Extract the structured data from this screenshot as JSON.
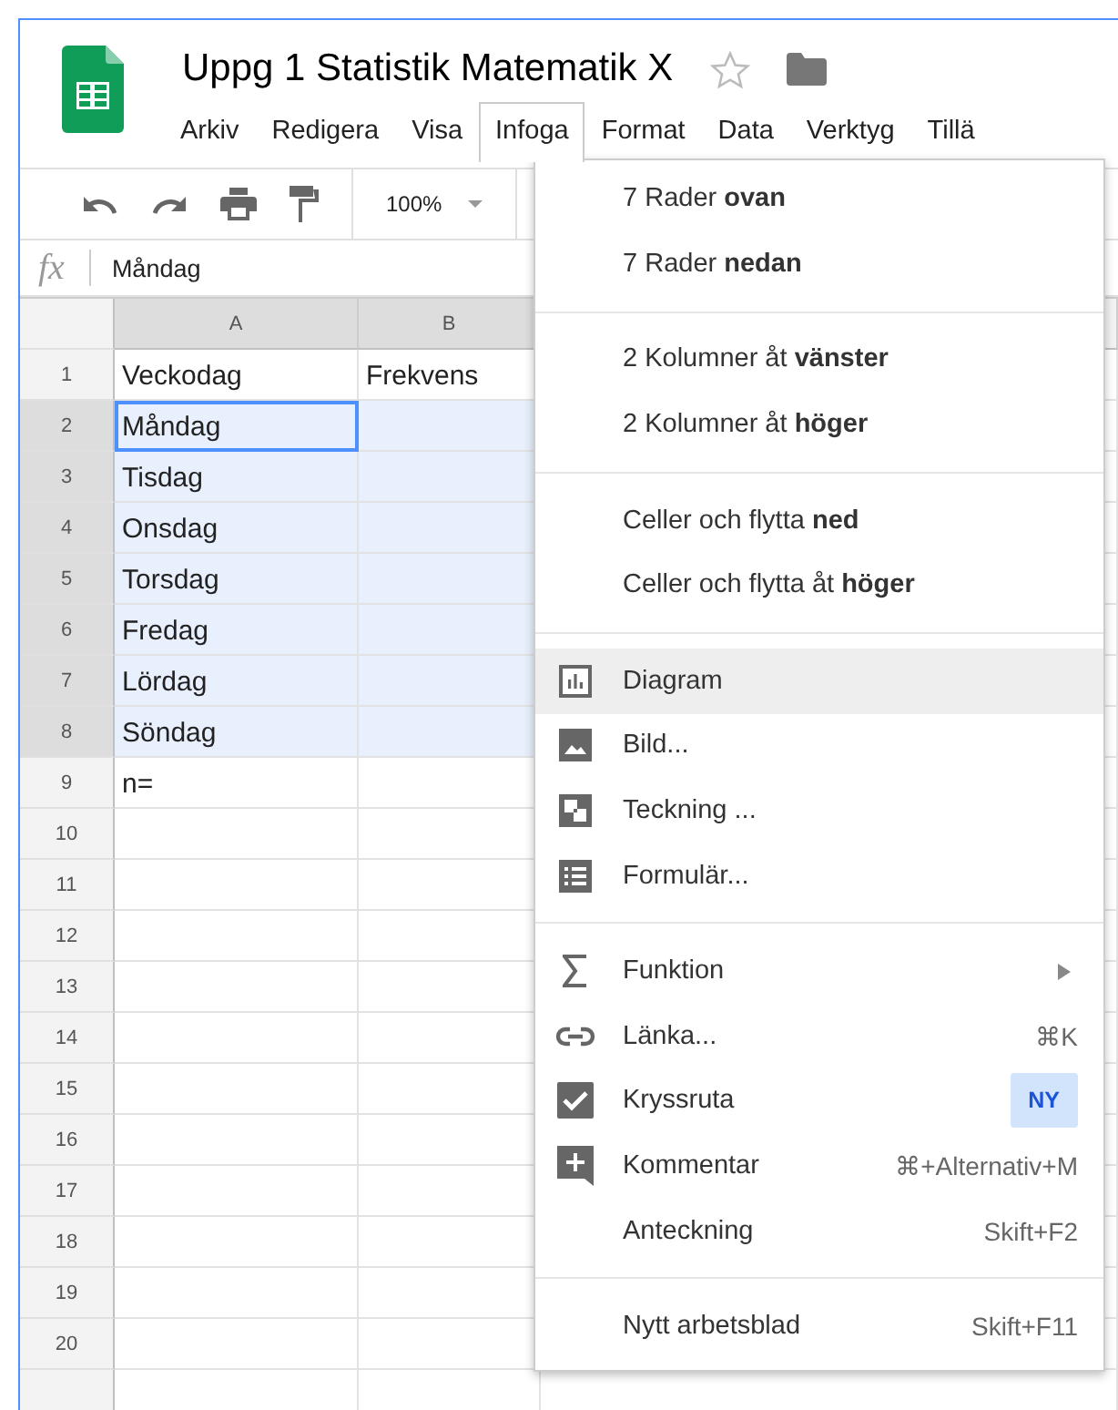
{
  "document": {
    "title": "Uppg 1 Statistik Matematik X"
  },
  "menubar": [
    {
      "label": "Arkiv",
      "selected": false
    },
    {
      "label": "Redigera",
      "selected": false
    },
    {
      "label": "Visa",
      "selected": false
    },
    {
      "label": "Infoga",
      "selected": true
    },
    {
      "label": "Format",
      "selected": false
    },
    {
      "label": "Data",
      "selected": false
    },
    {
      "label": "Verktyg",
      "selected": false
    },
    {
      "label": "Tillä",
      "selected": false
    }
  ],
  "toolbar": {
    "zoom": "100%"
  },
  "formula_bar": {
    "label": "fx",
    "value": "Måndag"
  },
  "columns": [
    {
      "label": "A",
      "selected": true
    },
    {
      "label": "B",
      "selected": true
    }
  ],
  "rows": [
    {
      "number": "1",
      "selected": false,
      "cells": [
        {
          "text": "Veckodag",
          "selected": false,
          "active": false
        },
        {
          "text": "Frekvens",
          "selected": false,
          "active": false
        }
      ]
    },
    {
      "number": "2",
      "selected": true,
      "cells": [
        {
          "text": "Måndag",
          "selected": true,
          "active": true
        },
        {
          "selected": true,
          "active": false
        }
      ]
    },
    {
      "number": "3",
      "selected": true,
      "cells": [
        {
          "text": "Tisdag",
          "selected": true,
          "active": false
        },
        {
          "selected": true,
          "active": false
        }
      ]
    },
    {
      "number": "4",
      "selected": true,
      "cells": [
        {
          "text": "Onsdag",
          "selected": true,
          "active": false
        },
        {
          "selected": true,
          "active": false
        }
      ]
    },
    {
      "number": "5",
      "selected": true,
      "cells": [
        {
          "text": "Torsdag",
          "selected": true,
          "active": false
        },
        {
          "selected": true,
          "active": false
        }
      ]
    },
    {
      "number": "6",
      "selected": true,
      "cells": [
        {
          "text": "Fredag",
          "selected": true,
          "active": false
        },
        {
          "selected": true,
          "active": false
        }
      ]
    },
    {
      "number": "7",
      "selected": true,
      "cells": [
        {
          "text": "Lördag",
          "selected": true,
          "active": false
        },
        {
          "selected": true,
          "active": false
        }
      ]
    },
    {
      "number": "8",
      "selected": true,
      "cells": [
        {
          "text": "Söndag",
          "selected": true,
          "active": false
        },
        {
          "selected": true,
          "active": false
        }
      ]
    },
    {
      "number": "9",
      "selected": false,
      "cells": [
        {
          "text": "n=",
          "selected": false,
          "active": false
        },
        {
          "selected": false,
          "active": false
        }
      ]
    },
    {
      "number": "10",
      "selected": false,
      "cells": [
        {
          "selected": false,
          "active": false
        },
        {
          "selected": false,
          "active": false
        }
      ]
    },
    {
      "number": "11",
      "selected": false,
      "cells": [
        {
          "selected": false,
          "active": false
        },
        {
          "selected": false,
          "active": false
        }
      ]
    },
    {
      "number": "12",
      "selected": false,
      "cells": [
        {
          "selected": false,
          "active": false
        },
        {
          "selected": false,
          "active": false
        }
      ]
    },
    {
      "number": "13",
      "selected": false,
      "cells": [
        {
          "selected": false,
          "active": false
        },
        {
          "selected": false,
          "active": false
        }
      ]
    },
    {
      "number": "14",
      "selected": false,
      "cells": [
        {
          "selected": false,
          "active": false
        },
        {
          "selected": false,
          "active": false
        }
      ]
    },
    {
      "number": "15",
      "selected": false,
      "cells": [
        {
          "selected": false,
          "active": false
        },
        {
          "selected": false,
          "active": false
        }
      ]
    },
    {
      "number": "16",
      "selected": false,
      "cells": [
        {
          "selected": false,
          "active": false
        },
        {
          "selected": false,
          "active": false
        }
      ]
    },
    {
      "number": "17",
      "selected": false,
      "cells": [
        {
          "selected": false,
          "active": false
        },
        {
          "selected": false,
          "active": false
        }
      ]
    },
    {
      "number": "18",
      "selected": false,
      "cells": [
        {
          "selected": false,
          "active": false
        },
        {
          "selected": false,
          "active": false
        }
      ]
    },
    {
      "number": "19",
      "selected": false,
      "cells": [
        {
          "selected": false,
          "active": false
        },
        {
          "selected": false,
          "active": false
        }
      ]
    },
    {
      "number": "20",
      "selected": false,
      "cells": [
        {
          "selected": false,
          "active": false
        },
        {
          "selected": false,
          "active": false
        }
      ]
    }
  ],
  "menu": {
    "sections": [
      {
        "items": [
          {
            "label": "7 Rader **ovan**",
            "selected": false
          },
          {
            "label": "7 Rader **nedan**",
            "selected": false
          }
        ]
      },
      {
        "items": [
          {
            "label": "2 Kolumner åt **vänster**",
            "selected": false
          },
          {
            "label": "2 Kolumner åt **höger**",
            "selected": false
          }
        ]
      },
      {
        "items": [
          {
            "label": "Celler och flytta **ned**",
            "selected": false
          },
          {
            "label": "Celler och flytta åt **höger**",
            "selected": false
          }
        ]
      },
      {
        "items": [
          {
            "label": "Diagram",
            "kind": "chart",
            "selected": true
          },
          {
            "label": "Bild...",
            "kind": "image",
            "selected": false
          },
          {
            "label": "Teckning ...",
            "kind": "drawing",
            "selected": false
          },
          {
            "label": "Formulär...",
            "kind": "form",
            "selected": false
          }
        ]
      },
      {
        "items": [
          {
            "label": "Funktion",
            "kind": "sigma",
            "submenu": true,
            "selected": false
          },
          {
            "label": "Länka...",
            "kind": "link",
            "shortcut": "⌘K",
            "selected": false
          },
          {
            "label": "Kryssruta",
            "kind": "checkbox",
            "badge": "NY",
            "selected": false
          },
          {
            "label": "Kommentar",
            "kind": "comment",
            "shortcut": "⌘+Alternativ+M",
            "selected": false
          },
          {
            "label": "Anteckning",
            "shortcut": "Skift+F2",
            "selected": false
          }
        ]
      },
      {
        "items": [
          {
            "label": "Nytt arbetsblad",
            "shortcut": "Skift+F11",
            "selected": false
          }
        ]
      }
    ]
  }
}
